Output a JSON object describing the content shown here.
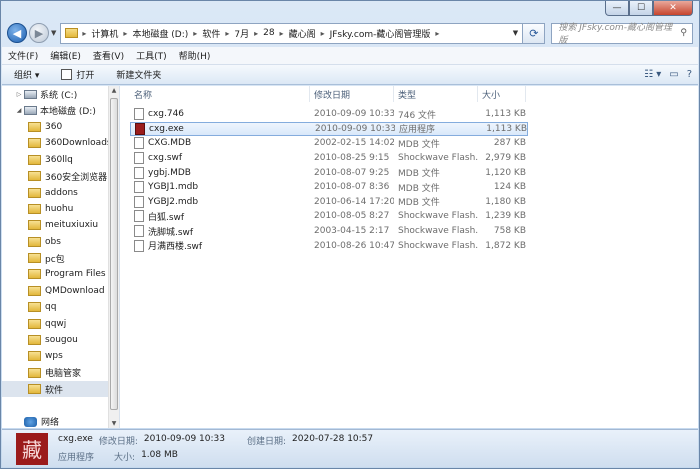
{
  "window": {
    "min_label": "—",
    "max_label": "☐",
    "close_label": "✕"
  },
  "nav_buttons": {
    "back_label": "◀",
    "forward_label": "▶",
    "history_label": "▼"
  },
  "address": {
    "crumbs": [
      "计算机",
      "本地磁盘 (D:)",
      "软件",
      "7月",
      "28",
      "藏心阁",
      "JFsky.com-藏心阁管理版"
    ],
    "separator": "▸",
    "dropdown_label": "▼",
    "refresh_label": "⟳"
  },
  "search": {
    "placeholder": "搜索 JFsky.com-藏心阁管理版",
    "icon_label": "⚲"
  },
  "menu": [
    "文件(F)",
    "编辑(E)",
    "查看(V)",
    "工具(T)",
    "帮助(H)"
  ],
  "toolbar": {
    "organize": "组织 ▾",
    "open": "打开",
    "new_folder": "新建文件夹",
    "view_label": "☷ ▾",
    "preview_label": "▭",
    "help_label": "?"
  },
  "sidebar": {
    "drives": [
      {
        "label": "系统 (C:)",
        "expanded": false
      },
      {
        "label": "本地磁盘 (D:)",
        "expanded": true
      }
    ],
    "folders": [
      "360",
      "360Downloads",
      "360llq",
      "360安全浏览器",
      "addons",
      "huohu",
      "meituxiuxiu",
      "obs",
      "pc包",
      "Program Files",
      "QMDownload",
      "qq",
      "qqwj",
      "sougou",
      "wps",
      "电脑管家",
      "软件"
    ],
    "selected_folder": "软件",
    "network": "网络"
  },
  "columns": {
    "name": "名称",
    "date": "修改日期",
    "type": "类型",
    "size": "大小"
  },
  "files": [
    {
      "name": "cxg.746",
      "date": "2010-09-09 10:33",
      "type": "746 文件",
      "size": "1,113 KB",
      "icon": "file"
    },
    {
      "name": "cxg.exe",
      "date": "2010-09-09 10:33",
      "type": "应用程序",
      "size": "1,113 KB",
      "icon": "exe",
      "selected": true
    },
    {
      "name": "CXG.MDB",
      "date": "2002-02-15 14:02",
      "type": "MDB 文件",
      "size": "287 KB",
      "icon": "file"
    },
    {
      "name": "cxg.swf",
      "date": "2010-08-25 9:15",
      "type": "Shockwave Flash...",
      "size": "2,979 KB",
      "icon": "file"
    },
    {
      "name": "ygbj.MDB",
      "date": "2010-08-07 9:25",
      "type": "MDB 文件",
      "size": "1,120 KB",
      "icon": "file"
    },
    {
      "name": "YGBJ1.mdb",
      "date": "2010-08-07 8:36",
      "type": "MDB 文件",
      "size": "124 KB",
      "icon": "file"
    },
    {
      "name": "YGBJ2.mdb",
      "date": "2010-06-14 17:20",
      "type": "MDB 文件",
      "size": "1,180 KB",
      "icon": "file"
    },
    {
      "name": "白狐.swf",
      "date": "2010-08-05 8:27",
      "type": "Shockwave Flash...",
      "size": "1,239 KB",
      "icon": "file"
    },
    {
      "name": "洗脚城.swf",
      "date": "2003-04-15 2:17",
      "type": "Shockwave Flash...",
      "size": "758 KB",
      "icon": "file"
    },
    {
      "name": "月满西楼.swf",
      "date": "2010-08-26 10:47",
      "type": "Shockwave Flash...",
      "size": "1,872 KB",
      "icon": "file"
    }
  ],
  "status": {
    "icon_glyph": "藏",
    "name": "cxg.exe",
    "modified_label": "修改日期:",
    "modified": "2010-09-09 10:33",
    "created_label": "创建日期:",
    "created": "2020-07-28 10:57",
    "type": "应用程序",
    "size_label": "大小:",
    "size": "1.08 MB"
  }
}
